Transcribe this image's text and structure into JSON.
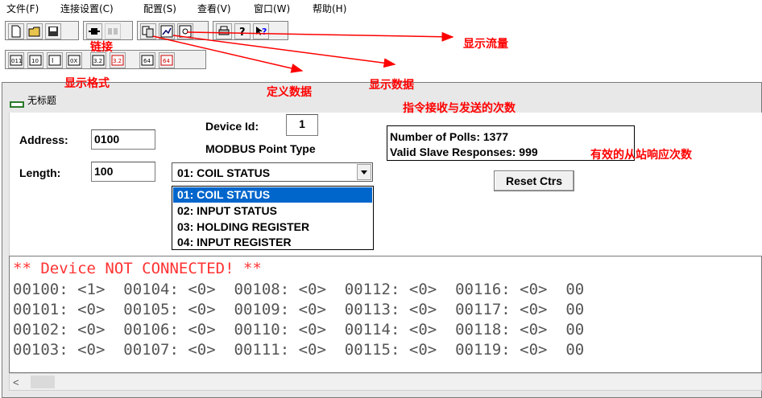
{
  "menu": [
    "文件(F)",
    "连接设置(C)",
    "配置(S)",
    "查看(V)",
    "窗口(W)",
    "帮助(H)"
  ],
  "annotations": {
    "link": "链接",
    "display_format": "显示格式",
    "define_data": "定义数据",
    "display_data": "显示数据",
    "display_traffic": "显示流量",
    "poll_count": "指令接收与发送的次数",
    "valid_responses": "有效的从站响应次数"
  },
  "window": {
    "title": "无标题"
  },
  "config": {
    "address_label": "Address:",
    "address_value": "0100",
    "length_label": "Length:",
    "length_value": "100",
    "device_id_label": "Device Id:",
    "device_id_value": "1",
    "point_type_label": "MODBUS Point Type",
    "selected_type": "01: COIL STATUS",
    "options": [
      "01: COIL STATUS",
      "02: INPUT STATUS",
      "03: HOLDING REGISTER",
      "04: INPUT REGISTER"
    ]
  },
  "counters": {
    "polls": "Number of Polls: 1377",
    "valid": "Valid Slave Responses: 999",
    "reset_label": "Reset Ctrs"
  },
  "data_area": {
    "status": "** Device NOT CONNECTED! **",
    "rows": [
      "00100: <1>  00104: <0>  00108: <0>  00112: <0>  00116: <0>  00",
      "00101: <0>  00105: <0>  00109: <0>  00113: <0>  00117: <0>  00",
      "00102: <0>  00106: <0>  00110: <0>  00114: <0>  00118: <0>  00",
      "00103: <0>  00107: <0>  00111: <0>  00115: <0>  00119: <0>  00"
    ]
  },
  "icons": {
    "toolbar1": [
      "new-file-icon",
      "open-folder-icon",
      "save-icon",
      "connect-icon",
      "disconnect-icon",
      "define-data-icon",
      "display-data-icon",
      "display-traffic-icon",
      "print-icon",
      "about-icon",
      "help-pointer-icon"
    ],
    "toolbar2": [
      "format-binary-icon",
      "format-decimal-icon",
      "format-integer-icon",
      "format-hex-icon",
      "format-float-icon",
      "format-float-swapped-icon",
      "format-double-icon",
      "format-double-swapped-icon"
    ]
  },
  "colors": {
    "annotation": "#ff0000",
    "selection": "#0066cc",
    "not_connected": "#ff3333"
  }
}
